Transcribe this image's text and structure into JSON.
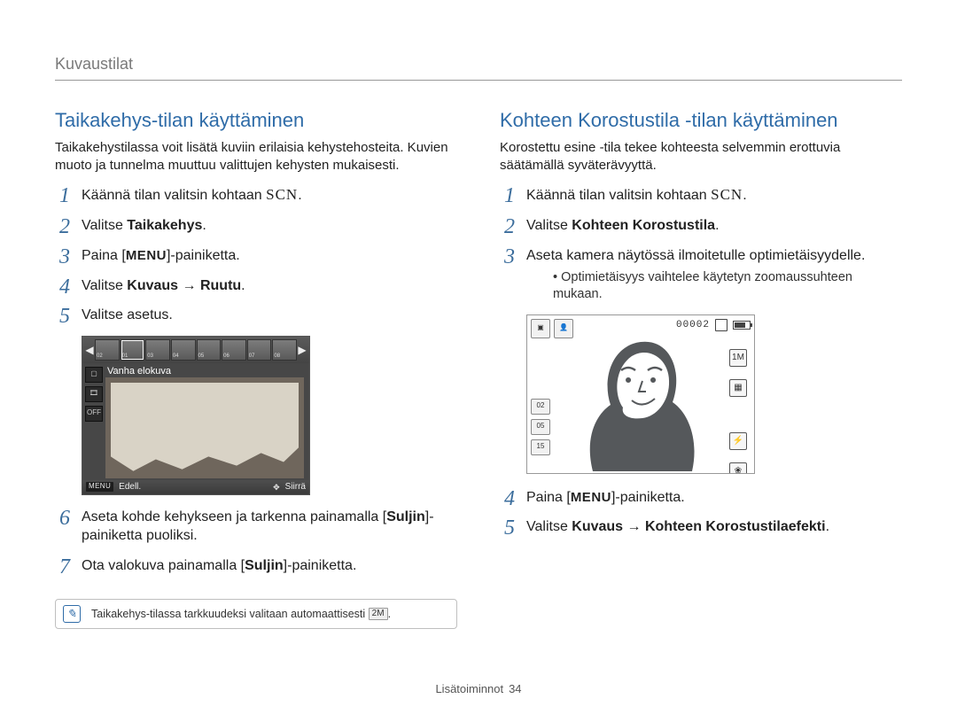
{
  "section_header": "Kuvaustilat",
  "footer": {
    "label": "Lisätoiminnot",
    "page": "34"
  },
  "left": {
    "heading": "Taikakehys-tilan käyttäminen",
    "intro": "Taikakehystilassa voit lisätä kuviin erilaisia kehystehosteita. Kuvien muoto ja tunnelma muuttuu valittujen kehysten mukaisesti.",
    "steps": {
      "s1_a": "Käännä tilan valitsin kohtaan ",
      "s1_scn": "SCN",
      "s1_b": ".",
      "s2_a": "Valitse ",
      "s2_bold": "Taikakehys",
      "s2_b": ".",
      "s3_a": "Paina [",
      "s3_menu": "MENU",
      "s3_b": "]-painiketta.",
      "s4_a": "Valitse ",
      "s4_bold1": "Kuvaus",
      "s4_arrow": " → ",
      "s4_bold2": "Ruutu",
      "s4_b": ".",
      "s5": "Valitse asetus.",
      "s6_a": "Aseta kohde kehykseen ja tarkenna painamalla [",
      "s6_bold": "Suljin",
      "s6_b": "]-painiketta puoliksi.",
      "s7_a": "Ota valokuva painamalla [",
      "s7_bold": "Suljin",
      "s7_b": "]-painiketta."
    },
    "screenshot": {
      "style_label": "Vanha elokuva",
      "thumbs": [
        "02",
        "01",
        "03",
        "04",
        "05",
        "06",
        "07",
        "08"
      ],
      "side_icons": [
        "▢",
        "🎞",
        "OFF"
      ],
      "footer_menu": "MENU",
      "footer_back": "Edell.",
      "footer_move_icon": "✥",
      "footer_move": "Siirrä"
    },
    "note": {
      "text_a": "Taikakehys-tilassa tarkkuudeksi valitaan automaattisesti ",
      "badge": "2M",
      "text_b": "."
    }
  },
  "right": {
    "heading": "Kohteen Korostustila -tilan käyttäminen",
    "intro": "Korostettu esine -tila tekee kohteesta selvemmin erottuvia säätämällä syväterävyyttä.",
    "steps": {
      "s1_a": "Käännä tilan valitsin kohtaan ",
      "s1_scn": "SCN",
      "s1_b": ".",
      "s2_a": "Valitse ",
      "s2_bold": "Kohteen Korostustila",
      "s2_b": ".",
      "s3": "Aseta kamera näytössä ilmoitetulle optimietäisyydelle.",
      "s3_sub": "Optimietäisyys vaihtelee käytetyn zoomaussuhteen mukaan.",
      "s4_a": "Paina [",
      "s4_menu": "MENU",
      "s4_b": "]-painiketta.",
      "s5_a": "Valitse ",
      "s5_bold1": "Kuvaus",
      "s5_arrow": " → ",
      "s5_bold2": "Kohteen Korostustilaefekti",
      "s5_b": "."
    },
    "screenshot": {
      "counter": "00002",
      "left_stack": [
        "02",
        "05",
        "15"
      ],
      "right_res": "1M",
      "right_grid": "▦",
      "right_flash": "⚡",
      "right_macro": "❀"
    }
  }
}
